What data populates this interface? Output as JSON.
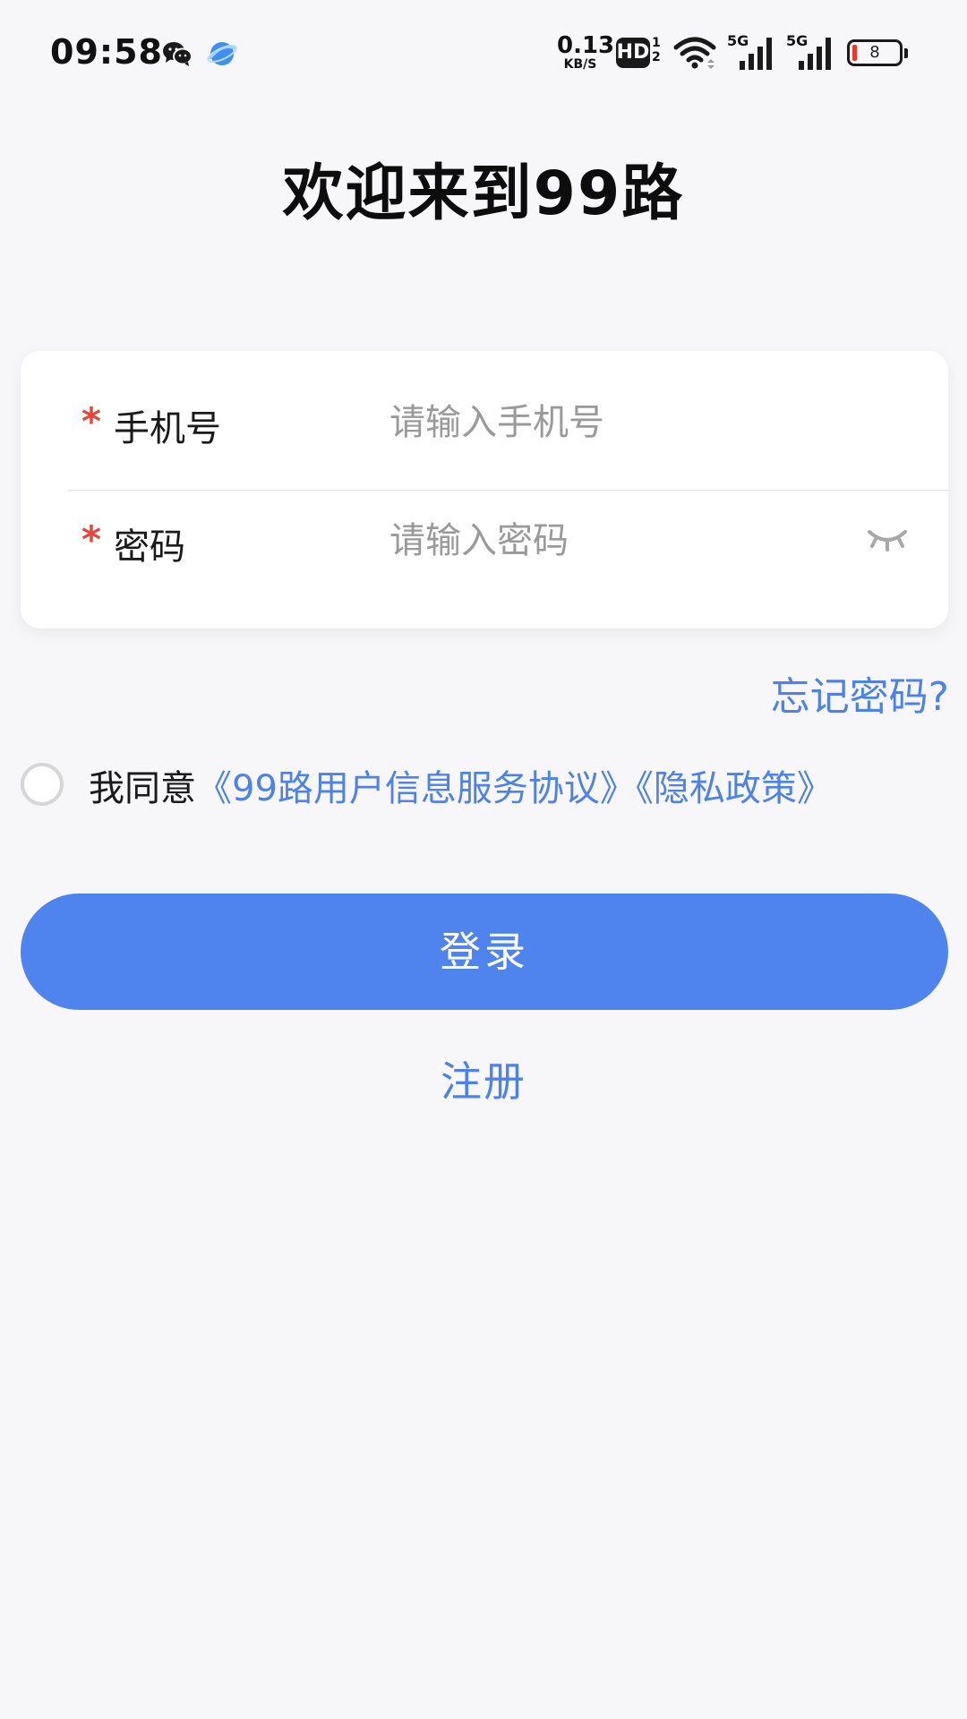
{
  "status_bar": {
    "time": "09:58",
    "net_speed_value": "0.13",
    "net_speed_unit": "KB/S",
    "hd_label": "HD",
    "hd_sub": "1\n2",
    "signal_1_label": "5G",
    "signal_2_label": "5G",
    "battery_level": "8",
    "battery_color": "#e8392f",
    "left_icons": [
      "wechat-icon",
      "browser-icon"
    ],
    "right_icons": [
      "wifi-icon",
      "signal-icon",
      "signal-icon",
      "battery-icon"
    ]
  },
  "page": {
    "title": "欢迎来到99路"
  },
  "form": {
    "required_mark": "*",
    "phone": {
      "label": "手机号",
      "value": "",
      "placeholder": "请输入手机号"
    },
    "password": {
      "label": "密码",
      "value": "",
      "placeholder": "请输入密码",
      "toggle_icon": "eye-closed-icon"
    }
  },
  "forgot_password_label": "忘记密码?",
  "agreement": {
    "prefix": "我同意",
    "terms_link": "《99路用户信息服务协议》",
    "privacy_link": "《隐私政策》",
    "checked": false
  },
  "actions": {
    "login_label": "登录",
    "register_label": "注册"
  },
  "colors": {
    "accent": "#4f84ee",
    "link": "#4e82e8",
    "required": "#e5463c",
    "background": "#f7f7f9"
  }
}
